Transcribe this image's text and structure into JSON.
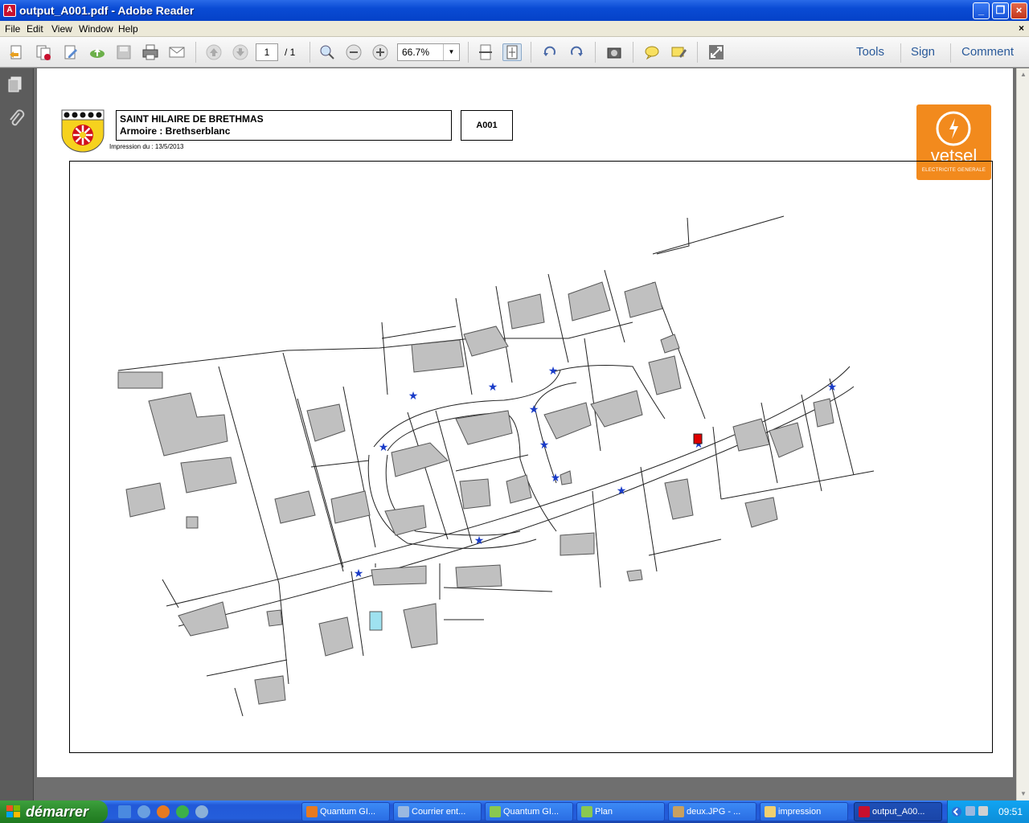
{
  "window": {
    "title": "output_A001.pdf - Adobe Reader"
  },
  "menu": [
    "File",
    "Edit",
    "View",
    "Window",
    "Help"
  ],
  "toolbar": {
    "page_current": "1",
    "page_total": "/ 1",
    "zoom": "66.7%",
    "tools_label": "Tools",
    "sign_label": "Sign",
    "comment_label": "Comment"
  },
  "document": {
    "commune": "SAINT HILAIRE DE BRETHMAS",
    "armoire": "Armoire : Brethserblanc",
    "code": "A001",
    "print_date": "Impression du : 13/5/2013",
    "brand_name": "vetsel",
    "brand_sub": "ELECTRICITE GENERALE"
  },
  "taskbar": {
    "start_label": "démarrer",
    "tasks": [
      "Quantum GI...",
      "Courrier ent...",
      "Quantum GI...",
      "Plan",
      "deux.JPG - ...",
      "impression",
      "output_A00..."
    ],
    "clock": "09:51"
  },
  "colors": {
    "titlebar": "#0a4bd4",
    "vetsel_orange": "#f28a1d",
    "building": "#c0c0c0",
    "lamp": "#1a3cc8",
    "cabinet": "#e00000"
  }
}
